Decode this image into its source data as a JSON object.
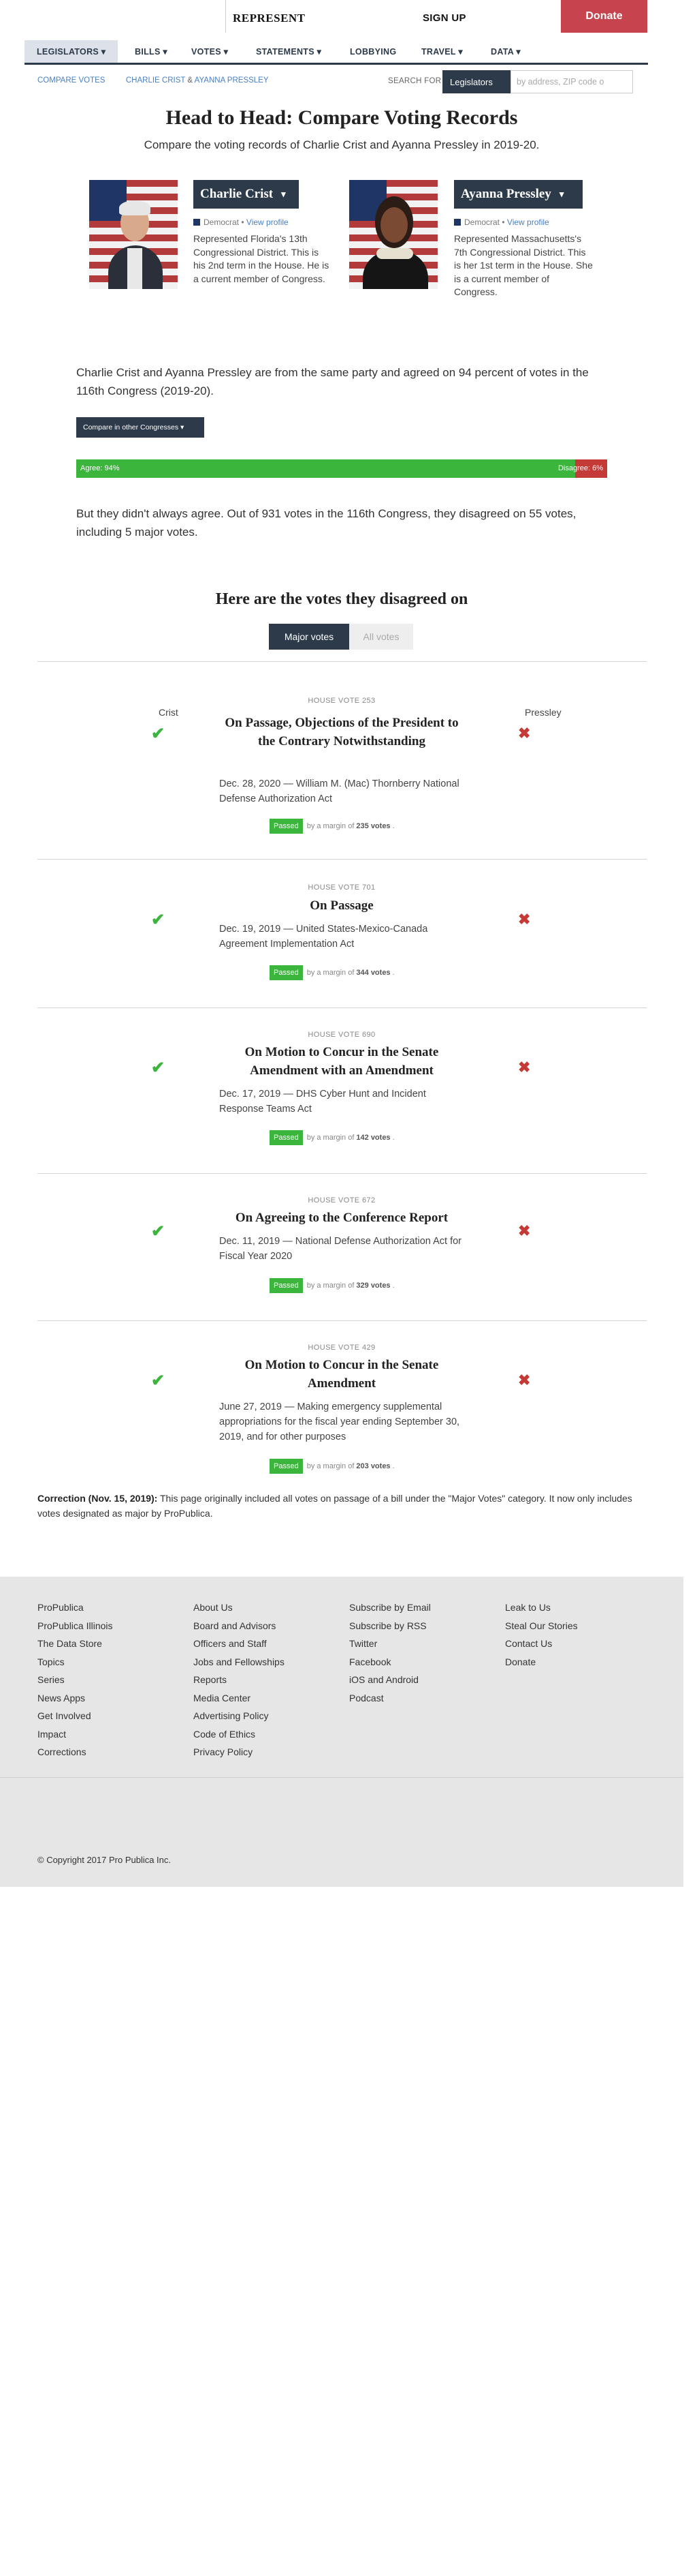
{
  "topbar": {
    "represent": "REPRESENT",
    "signup": "SIGN UP",
    "donate": "Donate"
  },
  "nav": {
    "items": [
      "LEGISLATORS ▾",
      "BILLS ▾",
      "VOTES ▾",
      "STATEMENTS ▾",
      "LOBBYING",
      "TRAVEL ▾",
      "DATA ▾"
    ]
  },
  "breadcrumb": {
    "root": "COMPARE VOTES",
    "a": "CHARLIE CRIST",
    "amp": "&",
    "b": "AYANNA PRESSLEY"
  },
  "search": {
    "label": "SEARCH FOR",
    "select": "Legislators",
    "placeholder": "by address, ZIP code o"
  },
  "page": {
    "title": "Head to Head: Compare Voting Records",
    "subtitle": "Compare the voting records of Charlie Crist and Ayanna Pressley in 2019-20."
  },
  "legislators": [
    {
      "name": "Charlie Crist",
      "caret": "▾",
      "party": "Democrat",
      "dot": "•",
      "link": "View profile",
      "bio": "Represented Florida's 13th Congressional District. This is his 2nd term in the House. He is a current member of Congress."
    },
    {
      "name": "Ayanna Pressley",
      "caret": "▾",
      "party": "Democrat",
      "dot": "•",
      "link": "View profile",
      "bio": "Represented Massachusetts's 7th Congressional District. This is her 1st term in the House. She is a current member of Congress."
    }
  ],
  "summary": {
    "agreement": "Charlie Crist and Ayanna Pressley are from the same party and agreed on 94 percent of votes in the 116th Congress (2019-20).",
    "compare_button": "Compare in other Congresses ▾",
    "agree_label": "Agree: 94%",
    "disagree_label": "Disagree: 6%",
    "agree_percent": 94,
    "disagreement": "But they didn't always agree. Out of 931 votes in the 116th Congress, they disagreed on 55 votes, including 5 major votes."
  },
  "disagreed": {
    "heading": "Here are the votes they disagreed on",
    "tabs": [
      "Major votes",
      "All votes"
    ],
    "member_a": "Crist",
    "member_b": "Pressley",
    "check": "✔",
    "cross": "✖",
    "votes": [
      {
        "label": "HOUSE VOTE 253",
        "title": "On Passage, Objections of the President to the Contrary Notwithstanding",
        "desc": "Dec. 28, 2020 — William M. (Mac) Thornberry National Defense Authorization Act",
        "status": "Passed",
        "margin_pre": "by a margin of",
        "margin": "235 votes",
        "margin_post": "."
      },
      {
        "label": "HOUSE VOTE 701",
        "title": "On Passage",
        "desc": "Dec. 19, 2019 — United States-Mexico-Canada Agreement Implementation Act",
        "status": "Passed",
        "margin_pre": "by a margin of",
        "margin": "344 votes",
        "margin_post": "."
      },
      {
        "label": "HOUSE VOTE 690",
        "title": "On Motion to Concur in the Senate Amendment with an Amendment",
        "desc": "Dec. 17, 2019 — DHS Cyber Hunt and Incident Response Teams Act",
        "status": "Passed",
        "margin_pre": "by a margin of",
        "margin": "142 votes",
        "margin_post": "."
      },
      {
        "label": "HOUSE VOTE 672",
        "title": "On Agreeing to the Conference Report",
        "desc": "Dec. 11, 2019 — National Defense Authorization Act for Fiscal Year 2020",
        "status": "Passed",
        "margin_pre": "by a margin of",
        "margin": "329 votes",
        "margin_post": "."
      },
      {
        "label": "HOUSE VOTE 429",
        "title": "On Motion to Concur in the Senate Amendment",
        "desc": "June 27, 2019 — Making emergency supplemental appropriations for the fiscal year ending September 30, 2019, and for other purposes",
        "status": "Passed",
        "margin_pre": "by a margin of",
        "margin": "203 votes",
        "margin_post": "."
      }
    ]
  },
  "correction": {
    "lead": "Correction (Nov. 15, 2019):",
    "text": " This page originally included all votes on passage of a bill under the \"Major Votes\" category. It now only includes votes designated as major by ProPublica."
  },
  "footer": {
    "col1": [
      "ProPublica",
      "ProPublica Illinois",
      "The Data Store",
      "Topics",
      "Series",
      "News Apps",
      "Get Involved",
      "Impact",
      "Corrections"
    ],
    "col2": [
      "About Us",
      "Board and Advisors",
      "Officers and Staff",
      "Jobs and Fellowships",
      "Reports",
      "Media Center",
      "Advertising Policy",
      "Code of Ethics",
      "Privacy Policy"
    ],
    "col3": [
      "Subscribe by Email",
      "Subscribe by RSS",
      "Twitter",
      "Facebook",
      "iOS and Android",
      "Podcast"
    ],
    "col4": [
      "Leak to Us",
      "Steal Our Stories",
      "Contact Us",
      "Donate"
    ],
    "copyright": "© Copyright 2017 Pro Publica Inc."
  }
}
